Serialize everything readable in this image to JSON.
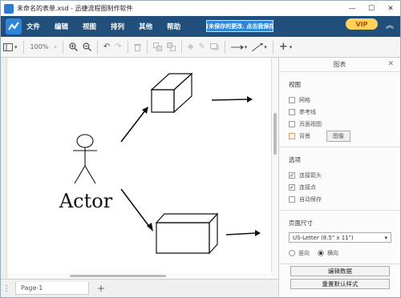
{
  "titlebar": {
    "title": "未命名的表单.xsd - 迅捷流程图制作软件",
    "minimize": "—",
    "maximize": "☐",
    "close": "✕"
  },
  "menubar": {
    "items": [
      {
        "label": "文件"
      },
      {
        "label": "编辑"
      },
      {
        "label": "视图"
      },
      {
        "label": "排列"
      },
      {
        "label": "其他"
      },
      {
        "label": "帮助"
      }
    ],
    "unsaved_notice": "有未保存的更改. 点击我保存.",
    "vip": "VIP",
    "collapse": "︽"
  },
  "toolbar": {
    "zoom": "100%",
    "icons": [
      "page-view-icon",
      "zoom-in-icon",
      "zoom-out-icon",
      "undo-icon",
      "redo-icon",
      "delete-icon",
      "to-front-icon",
      "to-back-icon",
      "fill-color-icon",
      "line-color-icon",
      "shadow-icon",
      "connection-icon",
      "waypoints-icon",
      "insert-icon"
    ]
  },
  "canvas": {
    "actor_label": "Actor"
  },
  "pagebar": {
    "menu": "⋮",
    "page_tab": "Page-1",
    "add": "+"
  },
  "panel": {
    "title": "图表",
    "close": "✕",
    "view_section": "视图",
    "view_options": [
      {
        "label": "网格",
        "checked": false
      },
      {
        "label": "参考线",
        "checked": false
      },
      {
        "label": "页面视图",
        "checked": false
      },
      {
        "label": "背景",
        "checked": false
      }
    ],
    "image_button": "图像",
    "options_section": "选项",
    "options": [
      {
        "label": "连接箭头",
        "checked": true
      },
      {
        "label": "连接点",
        "checked": true
      },
      {
        "label": "自动保存",
        "checked": false
      }
    ],
    "page_size_section": "页面尺寸",
    "page_size_value": "US-Letter (8.5\" x 11\")",
    "orientation": [
      {
        "label": "竖向",
        "selected": false
      },
      {
        "label": "横向",
        "selected": true
      }
    ],
    "edit_data_button": "编辑数据",
    "reset_style_button": "重置默认样式"
  }
}
